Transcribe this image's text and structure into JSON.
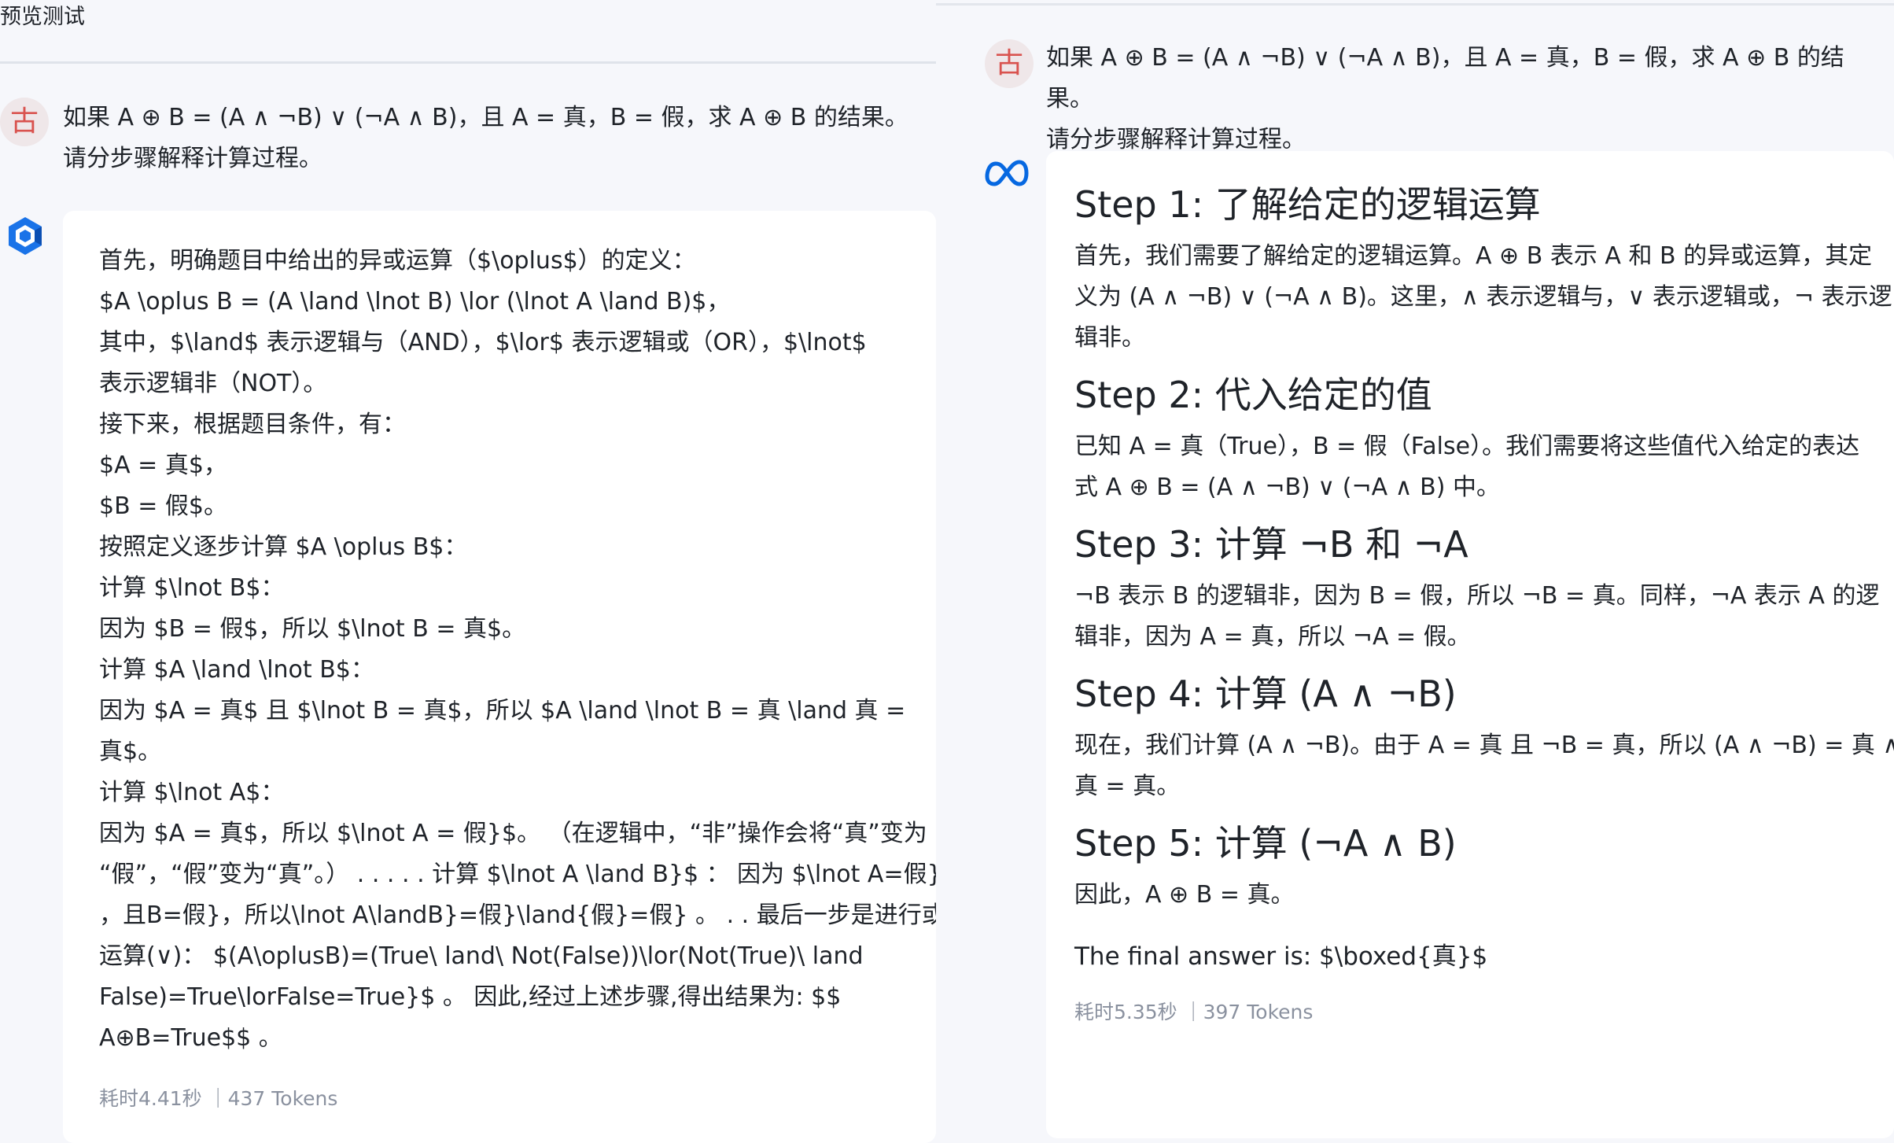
{
  "left": {
    "title": "预览测试",
    "user_avatar": "古",
    "user_message": "如果 A ⊕ B = (A ∧ ¬B) ∨ (¬A ∧ B)，且 A = 真，B = 假，求 A ⊕ B 的结果。\n请分步骤解释计算过程。",
    "model_icon": "cube-logo-icon",
    "answer_lines": [
      "首先，明确题目中给出的异或运算（$\\oplus$）的定义：",
      "$A \\oplus B = (A \\land \\lnot B) \\lor (\\lnot A \\land B)$，",
      "其中，$\\land$ 表示逻辑与（AND），$\\lor$ 表示逻辑或（OR），$\\lnot$",
      "表示逻辑非（NOT）。",
      "接下来，根据题目条件，有：",
      "$A = 真$，",
      "$B = 假$。",
      "按照定义逐步计算 $A \\oplus B$：",
      "计算 $\\lnot B$：",
      "因为 $B = 假$，所以 $\\lnot B = 真$。",
      "计算 $A \\land \\lnot B$：",
      "因为 $A = 真$ 且 $\\lnot B = 真$，所以 $A \\land \\lnot B = 真 \\land 真 =",
      "真$。",
      "计算 $\\lnot A$：",
      "因为 $A = 真$，所以 $\\lnot A = 假}$。 （在逻辑中，“非”操作会将“真”变为",
      "“假”，“假”变为“真”。） . . . . . 计算 $\\lnot A \\land B}$ ： 因为 $\\lnot A=假}",
      "，且B=假}，所以\\lnot A\\landB}=假}\\land{假}=假} 。 . . 最后一步是进行或",
      "运算(∨)： $(A\\oplusB)=(True\\ land\\ Not(False))\\lor(Not(True)\\ land",
      "False)=True\\lorFalse=True}$ 。 因此,经过上述步骤,得出结果为: $$",
      "A⊕B=True$$ 。"
    ],
    "meta": "耗时4.41秒 ｜437 Tokens"
  },
  "right": {
    "user_avatar": "古",
    "user_message": "如果 A ⊕ B = (A ∧ ¬B) ∨ (¬A ∧ B)，且 A = 真，B = 假，求 A ⊕ B 的结果。\n请分步骤解释计算过程。",
    "model_icon": "meta-infinity-logo-icon",
    "steps": [
      {
        "heading": "Step 1: 了解给定的逻辑运算",
        "lines": [
          "首先，我们需要了解给定的逻辑运算。A ⊕ B 表示 A 和 B 的异或运算，其定",
          "义为 (A ∧ ¬B) ∨ (¬A ∧ B)。这里，∧ 表示逻辑与，∨ 表示逻辑或，¬ 表示逻",
          "辑非。"
        ]
      },
      {
        "heading": "Step 2: 代入给定的值",
        "lines": [
          "已知 A = 真（True），B = 假（False）。我们需要将这些值代入给定的表达",
          "式 A ⊕ B = (A ∧ ¬B) ∨ (¬A ∧ B) 中。"
        ]
      },
      {
        "heading": "Step 3: 计算 ¬B 和 ¬A",
        "lines": [
          "¬B 表示 B 的逻辑非，因为 B = 假，所以 ¬B = 真。同样，¬A 表示 A 的逻",
          "辑非，因为 A = 真，所以 ¬A = 假。"
        ]
      },
      {
        "heading": "Step 4: 计算 (A ∧ ¬B)",
        "lines": [
          "现在，我们计算 (A ∧ ¬B)。由于 A = 真 且 ¬B = 真，所以 (A ∧ ¬B) = 真 ∧",
          "真 = 真。"
        ]
      },
      {
        "heading": "Step 5: 计算 (¬A ∧ B)",
        "lines": [
          "因此，A ⊕ B = 真。"
        ]
      }
    ],
    "final_answer": "The final answer is: $\\boxed{真}$",
    "meta": "耗时5.35秒 ｜397 Tokens"
  },
  "colors": {
    "background": "#f6f7fb",
    "card": "#ffffff",
    "avatar_bg": "#efe7e9",
    "avatar_text": "#d9534f",
    "meta_text": "#8a919f",
    "cube_logo": "#1a73e8",
    "meta_logo": "#0668e1"
  }
}
